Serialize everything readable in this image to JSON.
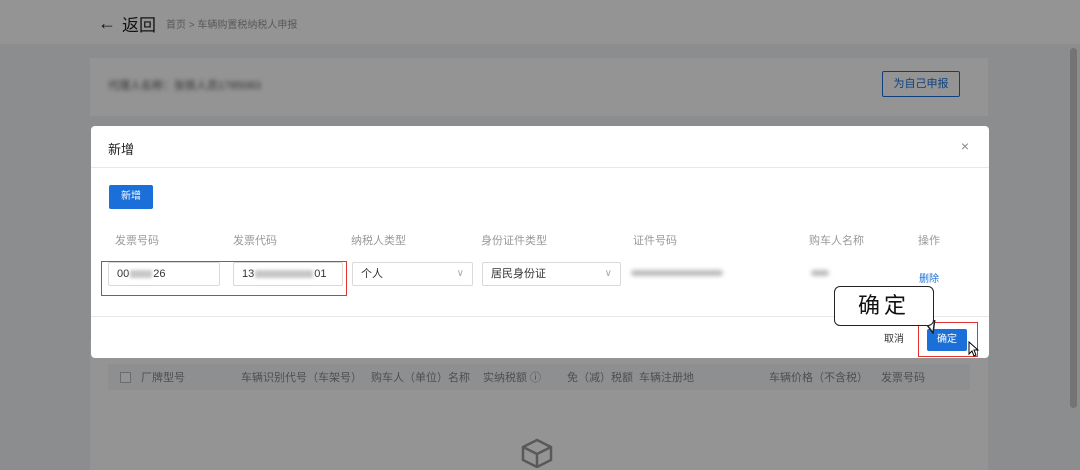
{
  "page": {
    "back_label": "返回",
    "breadcrumb": "首页 > 车辆购置税纳税人申报",
    "taxpayer_info": "代理人名称：张铁人员1785083",
    "self_declare_button": "为自己申报",
    "background_table_headers": [
      "厂牌型号",
      "车辆识别代号（车架号）",
      "购车人（单位）名称",
      "实纳税额 ⓘ",
      "免（减）税额",
      "车辆注册地",
      "车辆价格（不含税）",
      "发票号码"
    ]
  },
  "modal": {
    "title": "新增",
    "close_label": "×",
    "add_button": "新增",
    "columns": [
      "发票号码",
      "发票代码",
      "纳税人类型",
      "身份证件类型",
      "证件号码",
      "购车人名称",
      "操作"
    ],
    "row": {
      "invoice_no_prefix": "00",
      "invoice_no_suffix": "26",
      "invoice_code_prefix": "13",
      "invoice_code_suffix": "01",
      "taxpayer_type": "个人",
      "id_type": "居民身份证",
      "action": "删除"
    },
    "cancel_button": "取消",
    "confirm_button": "确定"
  },
  "callout": {
    "text": "确定"
  },
  "colors": {
    "primary": "#1a6fd8",
    "highlight": "#e3332f"
  }
}
